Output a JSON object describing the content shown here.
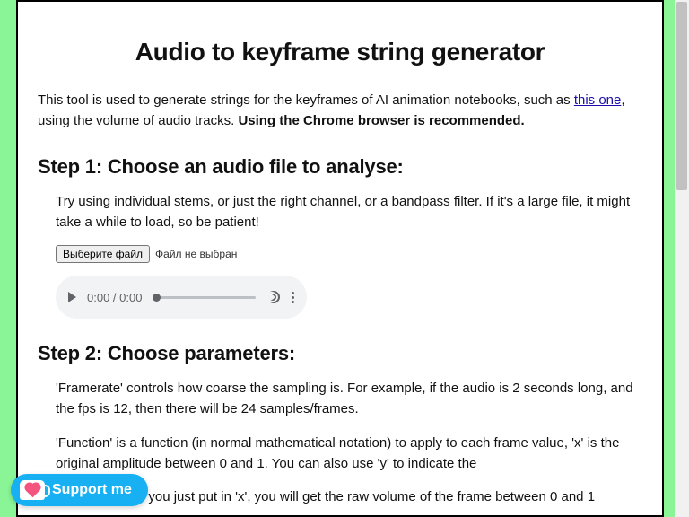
{
  "title": "Audio to keyframe string generator",
  "intro_a": "This tool is used to generate strings for the keyframes of AI animation notebooks, such as ",
  "intro_link": "this one",
  "intro_b": ", using the volume of audio tracks. ",
  "intro_bold": "Using the Chrome browser is recommended.",
  "step1": {
    "heading": "Step 1: Choose an audio file to analyse:",
    "tip": "Try using individual stems, or just the right channel, or a bandpass filter. If it's a large file, it might take a while to load, so be patient!",
    "file_btn": "Выберите файл",
    "file_status": "Файл не выбран"
  },
  "audio": {
    "time": "0:00 / 0:00"
  },
  "step2": {
    "heading": "Step 2: Choose parameters:",
    "p1": "'Framerate' controls how coarse the sampling is. For example, if the audio is 2 seconds long, and the fps is 12, then there will be 24 samples/frames.",
    "p2": "'Function' is a function (in normal mathematical notation) to apply to each frame value, 'x' is the original amplitude between 0 and 1. You can also use 'y' to indicate the",
    "p3": "For example, if you just put in 'x', you will get the raw volume of the frame between 0 and 1"
  },
  "support": "Support me"
}
